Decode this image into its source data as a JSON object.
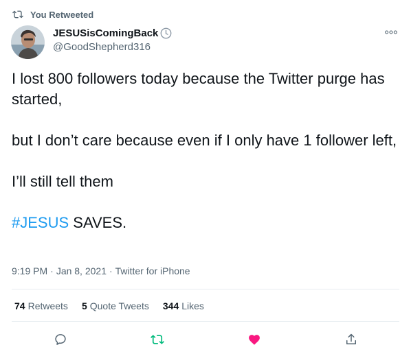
{
  "retweet_banner": {
    "text": "You Retweeted",
    "icon": "retweet-icon"
  },
  "author": {
    "display_name": "JESUSisComingBack",
    "handle": "@GoodShepherd316",
    "badge_icon": "clock-icon"
  },
  "tweet": {
    "paragraph_1": "I lost 800 followers today because the Twitter purge has started,",
    "paragraph_2": "but I don’t care because even if I only have 1 follower left,",
    "paragraph_3": "I’ll still tell them",
    "hashtag": "#JESUS",
    "closing": " SAVES."
  },
  "meta": {
    "time": "9:19 PM",
    "separator_1": "·",
    "date": "Jan 8, 2021",
    "separator_2": "·",
    "source": "Twitter for iPhone"
  },
  "stats": {
    "retweets_count": "74",
    "retweets_label": "Retweets",
    "quotes_count": "5",
    "quotes_label": "Quote Tweets",
    "likes_count": "344",
    "likes_label": "Likes"
  },
  "actions": [
    "reply-icon",
    "retweet-icon",
    "like-icon",
    "share-icon"
  ],
  "colors": {
    "accent": "#1d9bf0",
    "retweet_active": "#00ba7c",
    "like_active": "#f91880",
    "secondary_text": "#536471"
  }
}
